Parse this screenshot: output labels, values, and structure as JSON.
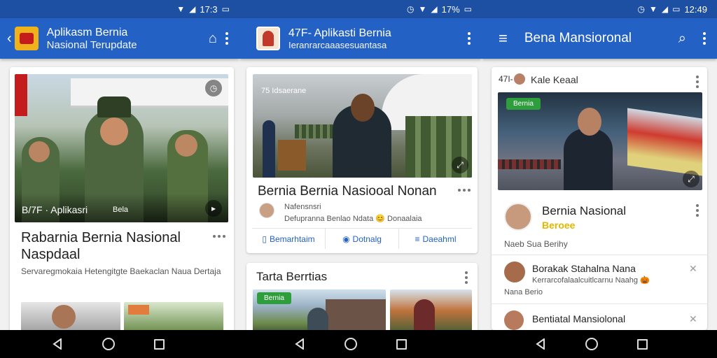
{
  "screen1": {
    "status": {
      "time": "17:3",
      "battery": "▮"
    },
    "appbar": {
      "title": "Aplikasm Bernia",
      "subtitle": "Nasional Terupdate"
    },
    "card": {
      "photo_caption": "B/7F · Aplikasri",
      "photo_caption2": "Bela",
      "headline": "Rabarnia Bernia Nasional Naspdaal",
      "snippet": "Servaregmokaia Hetengitgte Baekaclan Naua Dertaja"
    }
  },
  "screen2": {
    "status": {
      "time": "17%",
      "battery": "▮"
    },
    "appbar": {
      "title": "47F- Aplikasti Bernia",
      "subtitle": "Ieranrarcaaasesuantasa"
    },
    "card": {
      "photo_caption": "75 Idsaerane",
      "headline": "Bernia Bernia Nasiooal Nonan",
      "author": "Nafensnsri",
      "byline": "Defupranna Benlao Ndata 😊 Donaalaia",
      "buttons": [
        "Bemarhtaim",
        "Dotnalg",
        "Daeahml"
      ]
    },
    "card2": {
      "title": "Tarta Berrtias",
      "pill": "Bernia"
    }
  },
  "screen3": {
    "status": {
      "time": "12:49",
      "battery": "▮"
    },
    "appbar": {
      "title": "Bena Mansioronal"
    },
    "card": {
      "header_num": "47I-",
      "header_title": "Kale Keaal",
      "pill": "Bernia",
      "item1_title": "Bernia Nasional",
      "item1_sub": "Beroee",
      "item1_meta": "Naeb Sua Berihy"
    },
    "list": [
      {
        "title": "Borakak Stahalna Nana",
        "sub": "Kerrarcofalaalcuitlcarnu Naahg 🎃",
        "meta": "Nana Berio"
      },
      {
        "title": "Bentiatal Mansiolonal"
      }
    ]
  },
  "colors": {
    "statusbar": "#1d4fa3",
    "appbar": "#2461c4",
    "accent_green": "#2e9d3c"
  }
}
